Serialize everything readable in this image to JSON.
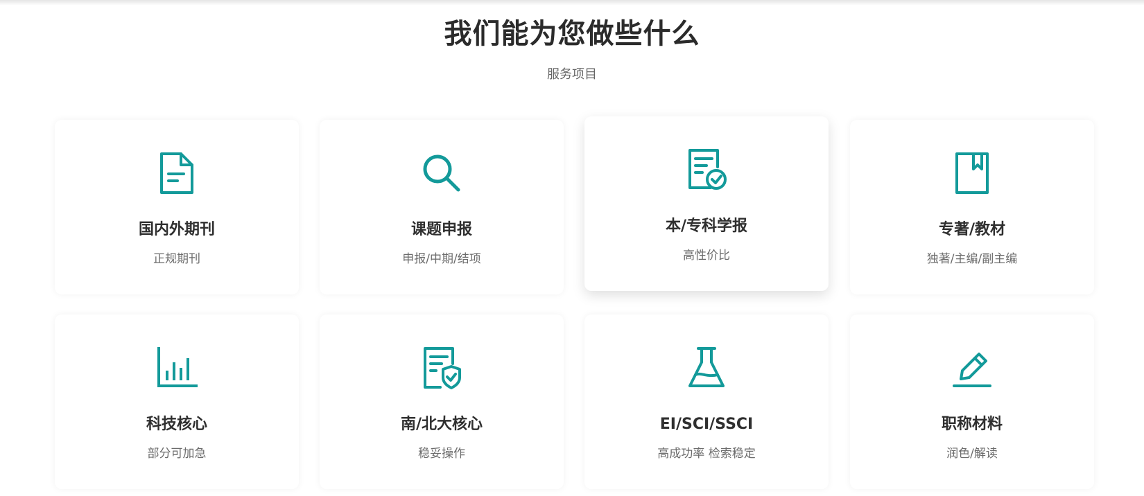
{
  "section": {
    "title": "我们能为您做些什么",
    "subtitle": "服务项目"
  },
  "colors": {
    "accent": "#139a9a",
    "title_text": "#2b2b2b",
    "desc_text": "#6b6b6b"
  },
  "services": [
    {
      "title": "国内外期刊",
      "desc": "正规期刊",
      "icon": "document-icon"
    },
    {
      "title": "课题申报",
      "desc": "申报/中期/结项",
      "icon": "search-icon"
    },
    {
      "title": "本/专科学报",
      "desc": "高性价比",
      "icon": "certificate-check-icon"
    },
    {
      "title": "专著/教材",
      "desc": "独著/主编/副主编",
      "icon": "book-icon"
    },
    {
      "title": "科技核心",
      "desc": "部分可加急",
      "icon": "bar-chart-icon"
    },
    {
      "title": "南/北大核心",
      "desc": "稳妥操作",
      "icon": "document-shield-icon"
    },
    {
      "title": "EI/SCI/SSCI",
      "desc": "高成功率 检索稳定",
      "icon": "flask-icon"
    },
    {
      "title": "职称材料",
      "desc": "润色/解读",
      "icon": "pencil-edit-icon"
    }
  ]
}
